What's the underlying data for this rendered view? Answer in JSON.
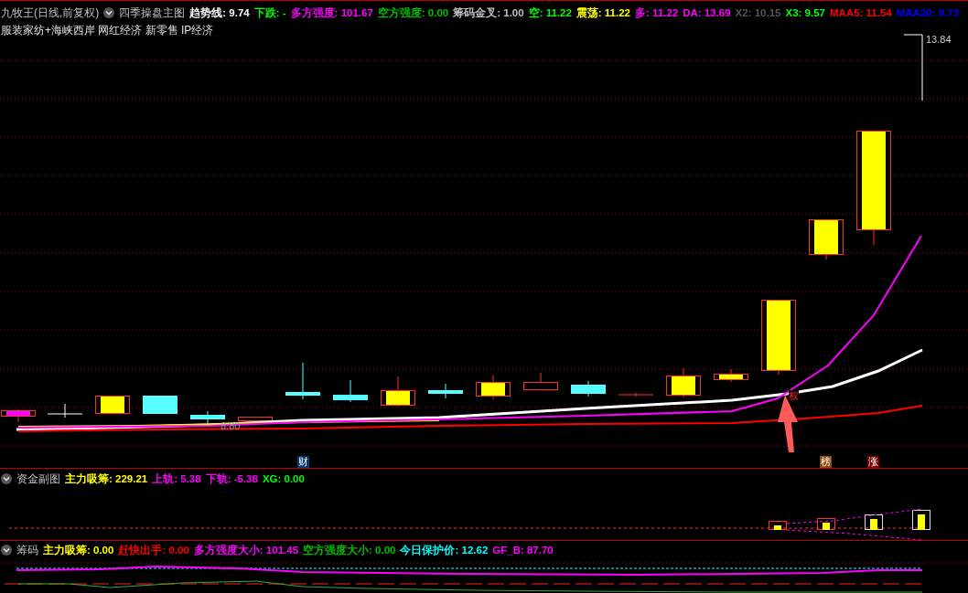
{
  "main_panel": {
    "title": "九牧王(日线,前复权)",
    "indicator": "四季操盘主图",
    "readouts": [
      {
        "text": "趋势线: 9.74",
        "color": "#ffffff"
      },
      {
        "text": "下跌: -",
        "color": "#00ff00"
      },
      {
        "text": "多方强度: 101.67",
        "color": "#ff00ff"
      },
      {
        "text": "空方强度: 0.00",
        "color": "#00c000"
      },
      {
        "text": "筹码金叉: 1.00",
        "color": "#c0c0c0"
      },
      {
        "text": "空: 11.22",
        "color": "#00ff00"
      },
      {
        "text": "震荡: 11.22",
        "color": "#ffff00"
      },
      {
        "text": "多: 11.22",
        "color": "#ff00ff"
      },
      {
        "text": "DA: 13.69",
        "color": "#ff00ff"
      },
      {
        "text": "X2: 10.15",
        "color": "#555555"
      },
      {
        "text": "X3: 9.57",
        "color": "#00ff00"
      },
      {
        "text": "MAA5: 11.54",
        "color": "#ff0000"
      },
      {
        "text": "MAA20: 9.73",
        "color": "#0000ff"
      }
    ],
    "concepts": "服装家纺+海峡西岸 网红经济 新零售 IP经济",
    "high_label": "13.84",
    "low_label": "8.80",
    "cross_label": "权",
    "markers": [
      {
        "text": "财",
        "color": "#003a70"
      },
      {
        "text": "榜",
        "color": "#8a4a10"
      },
      {
        "text": "涨",
        "color": "#7a0000"
      }
    ]
  },
  "fund_panel": {
    "indicator": "资金副图",
    "readouts": [
      {
        "text": "主力吸筹: 229.21",
        "color": "#ffff00"
      },
      {
        "text": "上轨: 5.38",
        "color": "#ff00ff"
      },
      {
        "text": "下轨: -5.38",
        "color": "#ff00ff"
      },
      {
        "text": "XG: 0.00",
        "color": "#00ff00"
      }
    ]
  },
  "chip_panel": {
    "indicator": "筹码",
    "readouts": [
      {
        "text": "主力吸筹: 0.00",
        "color": "#ffff00"
      },
      {
        "text": "赶快出手: 0.00",
        "color": "#ff0000"
      },
      {
        "text": "多方强度大小: 101.45",
        "color": "#ff00ff"
      },
      {
        "text": "空方强度大小: 0.00",
        "color": "#00c000"
      },
      {
        "text": "今日保护价: 12.62",
        "color": "#00ffff"
      },
      {
        "text": "GF_B: 87.70",
        "color": "#ff00ff"
      }
    ]
  }
}
